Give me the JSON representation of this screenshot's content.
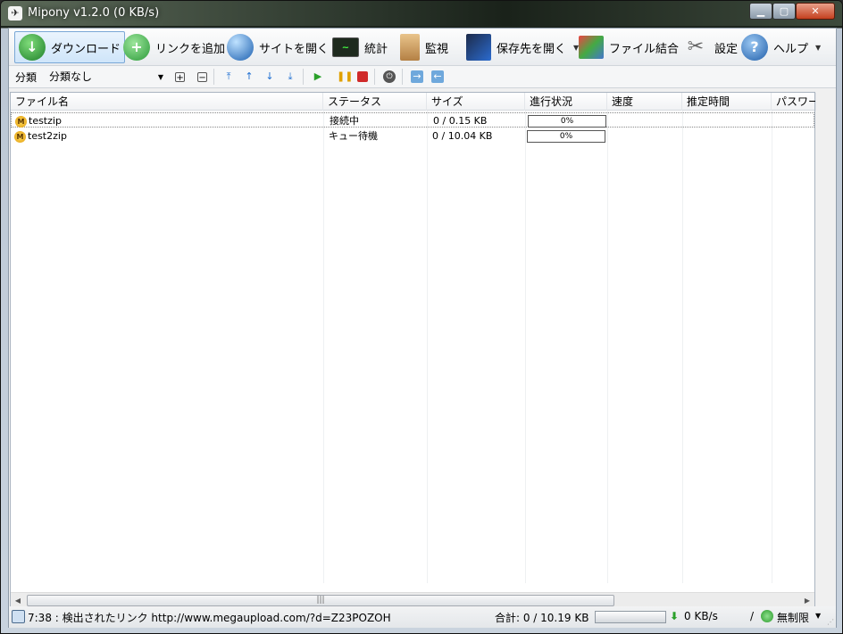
{
  "window": {
    "title": "Mipony v1.2.0 (0 KB/s)",
    "min": "▁",
    "max": "▢",
    "close": "✕"
  },
  "toolbar": {
    "download": "ダウンロード",
    "add_link": "リンクを追加",
    "open_site": "サイトを開く",
    "stats": "統計",
    "monitor": "監視",
    "open_folder": "保存先を開く",
    "file_join": "ファイル結合",
    "settings": "設定",
    "help": "ヘルプ"
  },
  "toolbar2": {
    "category_label": "分類",
    "category_value": "分類なし"
  },
  "columns": [
    "ファイル名",
    "ステータス",
    "サイズ",
    "進行状況",
    "速度",
    "推定時間",
    "パスワード"
  ],
  "rows": [
    {
      "name": "testzip",
      "status": "接続中",
      "size": "0 / 0.15 KB",
      "progress": "0%",
      "progress_value": 0,
      "speed": "",
      "eta": "",
      "password": ""
    },
    {
      "name": "test2zip",
      "status": "キュー待機",
      "size": "0 / 10.04 KB",
      "progress": "0%",
      "progress_value": 0,
      "speed": "",
      "eta": "",
      "password": ""
    }
  ],
  "statusbar": {
    "message": "7:38 : 検出されたリンク http://www.megaupload.com/?d=Z23POZOH",
    "total": "合計: 0 / 10.19 KB",
    "speed": "0 KB/s",
    "slash": "/",
    "limit": "無制限"
  },
  "colors": {
    "accent": "#7aa8d6",
    "progress_border": "#555555",
    "ok_green": "#2aa02a"
  },
  "icons": {
    "download": "download-globe-icon",
    "add_link": "plus-circle-icon",
    "open_site": "globe-icon",
    "stats": "monitor-graph-icon",
    "monitor": "clipboard-icon",
    "open_folder": "folder-icon",
    "file_join": "puzzle-join-icon",
    "settings": "tools-icon",
    "help": "question-icon",
    "file": "megaupload-icon"
  }
}
